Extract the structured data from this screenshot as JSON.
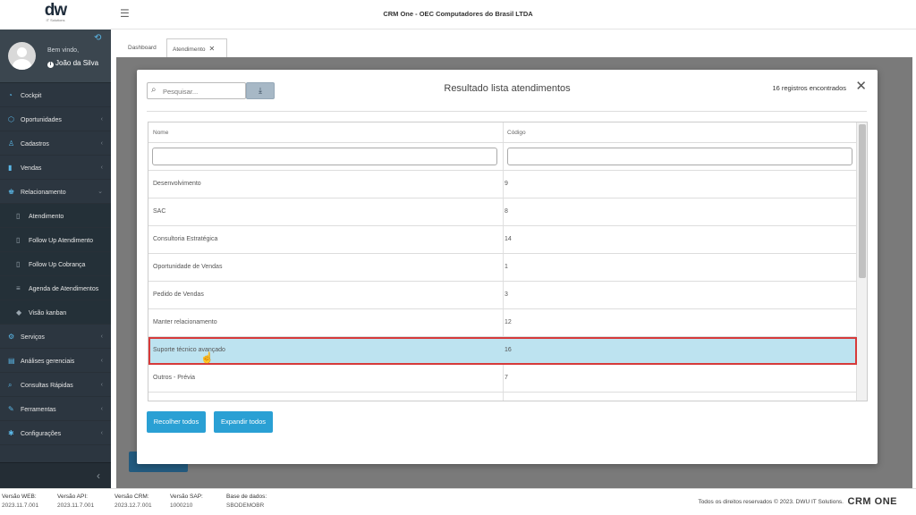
{
  "app": {
    "title": "CRM One - OEC Computadores do Brasil LTDA",
    "logo": "dw",
    "logo_sub": "IT Solutions"
  },
  "sidebar": {
    "welcome": "Bem vindo,",
    "user": "João da Silva",
    "items": [
      {
        "label": "Cockpit",
        "icon": "dashboard-icon"
      },
      {
        "label": "Oportunidades",
        "icon": "opportunity-icon",
        "chevron": "‹"
      },
      {
        "label": "Cadastros",
        "icon": "user-icon",
        "chevron": "‹"
      },
      {
        "label": "Vendas",
        "icon": "chart-icon",
        "chevron": "‹"
      },
      {
        "label": "Relacionamento",
        "icon": "people-icon",
        "chevron": "⌄"
      },
      {
        "label": "Atendimento",
        "icon": "document-icon",
        "sub": true
      },
      {
        "label": "Follow Up Atendimento",
        "icon": "document-icon",
        "sub": true
      },
      {
        "label": "Follow Up Cobrança",
        "icon": "document-icon",
        "sub": true
      },
      {
        "label": "Agenda de Atendimentos",
        "icon": "list-icon",
        "sub": true
      },
      {
        "label": "Visão kanban",
        "icon": "kanban-icon",
        "sub": true
      },
      {
        "label": "Serviços",
        "icon": "gear-icon",
        "chevron": "‹"
      },
      {
        "label": "Análises gerenciais",
        "icon": "analysis-icon",
        "chevron": "‹"
      },
      {
        "label": "Consultas Rápidas",
        "icon": "search-icon",
        "chevron": "‹"
      },
      {
        "label": "Ferramentas",
        "icon": "wrench-icon",
        "chevron": "‹"
      },
      {
        "label": "Configurações",
        "icon": "settings-icon",
        "chevron": "‹"
      }
    ]
  },
  "tabs": [
    {
      "label": "Dashboard"
    },
    {
      "label": "Atendimento"
    }
  ],
  "modal": {
    "search_placeholder": "Pesquisar...",
    "title": "Resultado lista atendimentos",
    "record_count": "16 registros encontrados",
    "columns": {
      "name": "Nome",
      "code": "Código"
    },
    "rows": [
      {
        "name": "Desenvolvimento",
        "code": "9"
      },
      {
        "name": "SAC",
        "code": "8"
      },
      {
        "name": "Consultoria Estratégica",
        "code": "14"
      },
      {
        "name": "Oportunidade de Vendas",
        "code": "1"
      },
      {
        "name": "Pedido de Vendas",
        "code": "3"
      },
      {
        "name": "Manter relacionamento",
        "code": "12"
      },
      {
        "name": "Suporte técnico avançado",
        "code": "16"
      },
      {
        "name": "Outros - Prévia",
        "code": "7"
      }
    ],
    "selected_index": 6,
    "buttons": {
      "collapse_all": "Recolher todos",
      "expand_all": "Expandir todos"
    }
  },
  "footer": {
    "versions": [
      {
        "label": "Versão WEB:",
        "value": "2023.11.7.001"
      },
      {
        "label": "Versão API:",
        "value": "2023.11.7.001"
      },
      {
        "label": "Versão CRM:",
        "value": "2023.12.7.001"
      },
      {
        "label": "Versão SAP:",
        "value": "1000210"
      },
      {
        "label": "Base de dados:",
        "value": "SBODEMOBR"
      }
    ],
    "copyright": "Todos os direitos reservados © 2023.   DWU IT Solutions.",
    "brand": "CRM ONE"
  }
}
